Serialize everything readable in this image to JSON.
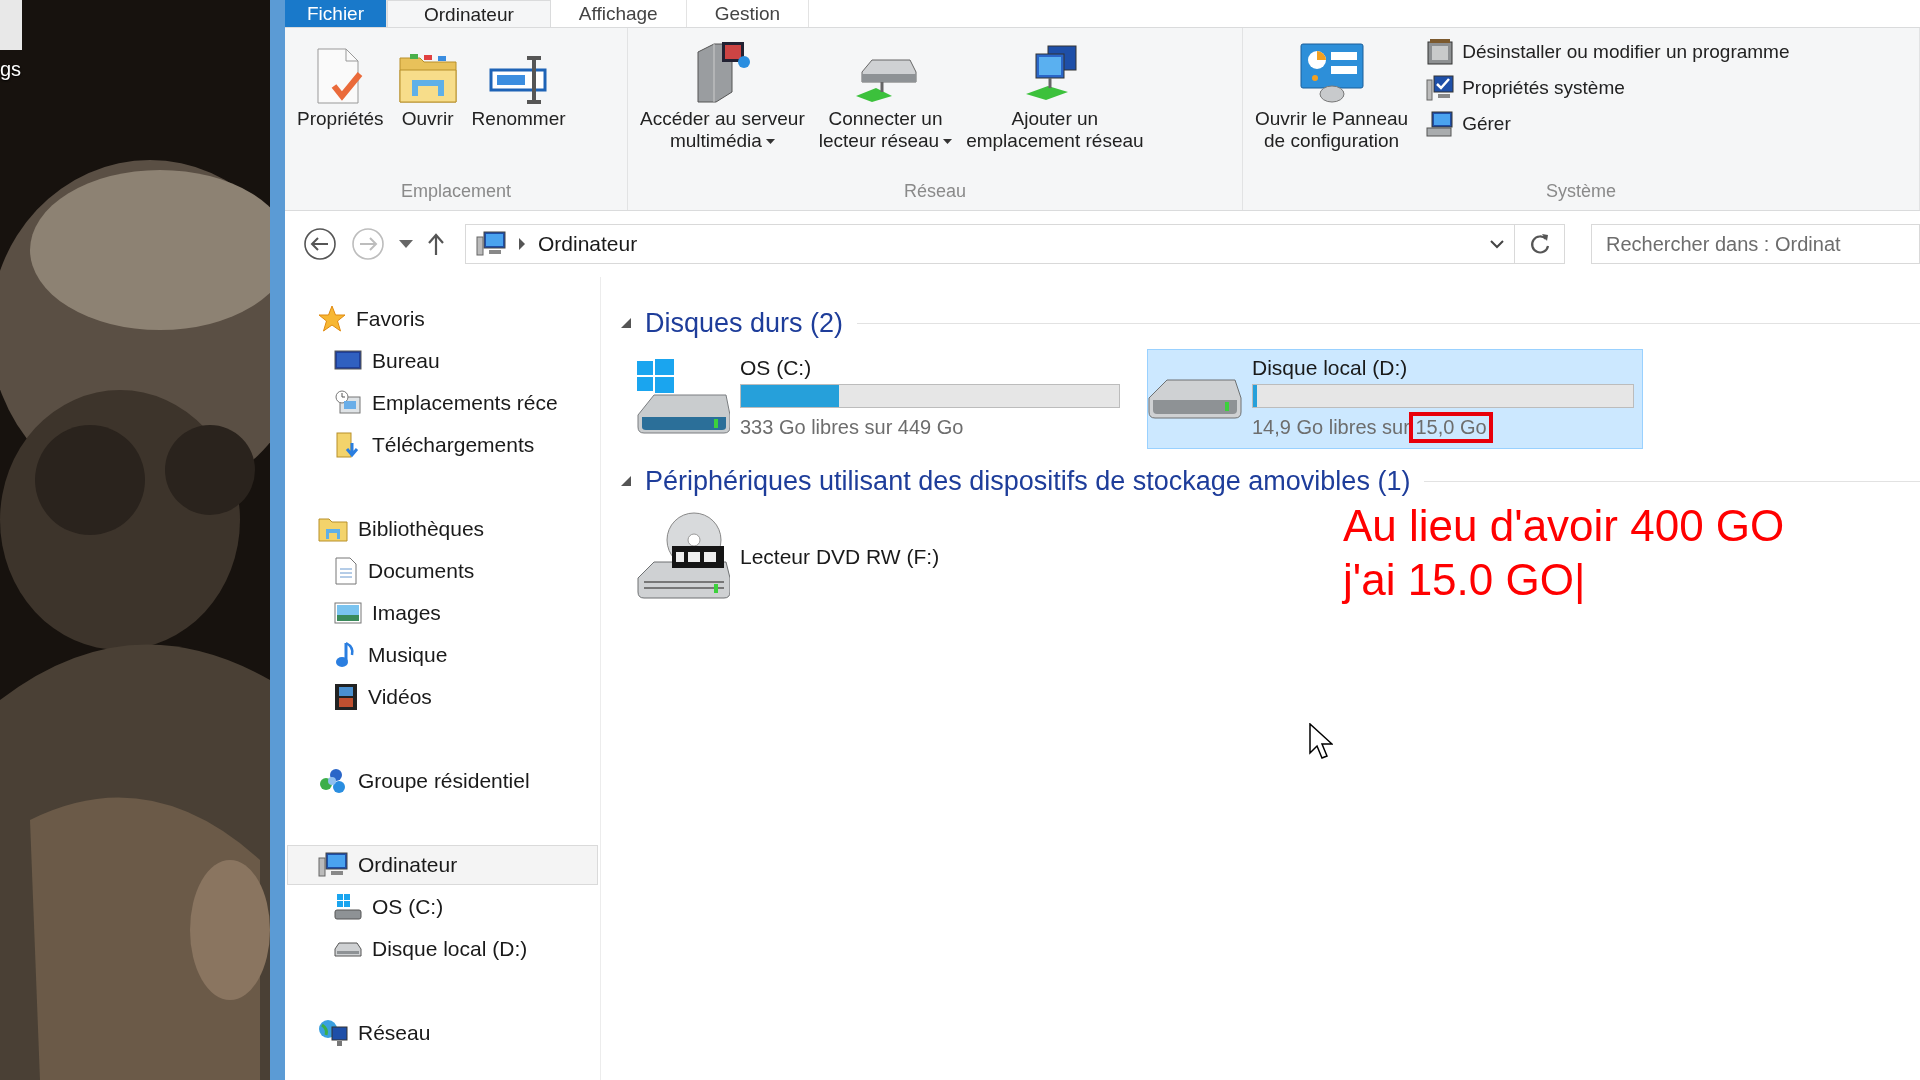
{
  "desktop": {
    "icon_label": "gs"
  },
  "tabs": [
    {
      "label": "Fichier",
      "kind": "file",
      "selected": false
    },
    {
      "label": "Ordinateur",
      "kind": "tab",
      "selected": true
    },
    {
      "label": "Affichage",
      "kind": "tab",
      "selected": false
    },
    {
      "label": "Gestion",
      "kind": "tab",
      "selected": false
    }
  ],
  "ribbon": {
    "groups": [
      {
        "label": "Emplacement",
        "buttons": [
          {
            "lines": [
              "Propriétés"
            ],
            "dropdown": false
          },
          {
            "lines": [
              "Ouvrir"
            ],
            "dropdown": false
          },
          {
            "lines": [
              "Renommer"
            ],
            "dropdown": false
          }
        ]
      },
      {
        "label": "Réseau",
        "buttons": [
          {
            "lines": [
              "Accéder au serveur",
              "multimédia"
            ],
            "dropdown": true
          },
          {
            "lines": [
              "Connecter un",
              "lecteur réseau"
            ],
            "dropdown": true
          },
          {
            "lines": [
              "Ajouter un",
              "emplacement réseau"
            ],
            "dropdown": false
          }
        ]
      },
      {
        "label": "Système",
        "buttons": [
          {
            "lines": [
              "Ouvrir le Panneau",
              "de configuration"
            ],
            "dropdown": false
          }
        ],
        "links": [
          "Désinstaller ou modifier un programme",
          "Propriétés système",
          "Gérer"
        ]
      }
    ]
  },
  "navigation": {
    "back_disabled": false,
    "forward_disabled": true
  },
  "address": {
    "path": "Ordinateur"
  },
  "search": {
    "placeholder": "Rechercher dans : Ordinat"
  },
  "sidebar": {
    "items": [
      {
        "label": "Favoris",
        "selected": false,
        "children": [
          {
            "label": "Bureau",
            "selected": false
          },
          {
            "label": "Emplacements réce",
            "selected": false
          },
          {
            "label": "Téléchargements",
            "selected": false
          }
        ]
      },
      {
        "label": "Bibliothèques",
        "selected": false,
        "children": [
          {
            "label": "Documents",
            "selected": false
          },
          {
            "label": "Images",
            "selected": false
          },
          {
            "label": "Musique",
            "selected": false
          },
          {
            "label": "Vidéos",
            "selected": false
          }
        ]
      },
      {
        "label": "Groupe résidentiel",
        "selected": false
      },
      {
        "label": "Ordinateur",
        "selected": true,
        "children": [
          {
            "label": "OS (C:)",
            "selected": false
          },
          {
            "label": "Disque local (D:)",
            "selected": false
          }
        ]
      },
      {
        "label": "Réseau",
        "selected": false
      }
    ]
  },
  "sections": [
    {
      "title": "Disques durs (2)",
      "expanded": true,
      "items": [
        {
          "kind": "drive",
          "name": "OS (C:)",
          "selected": false,
          "level": 0.26,
          "usage": "333 Go libres sur",
          "total": "449 Go",
          "total_marked": false
        },
        {
          "kind": "drive",
          "name": "Disque local (D:)",
          "selected": true,
          "level": 0.01,
          "usage": "14,9 Go libres sur",
          "total": "15,0 Go",
          "total_marked": true
        }
      ]
    },
    {
      "title": "Périphériques utilisant des dispositifs de stockage amovibles (1)",
      "expanded": true,
      "items": [
        {
          "kind": "device",
          "name": "Lecteur DVD RW (F:)",
          "selected": false
        }
      ]
    }
  ],
  "annotation": {
    "lines": [
      "Au lieu d'avoir 400 GO",
      "j'ai 15.0 GO|"
    ]
  }
}
